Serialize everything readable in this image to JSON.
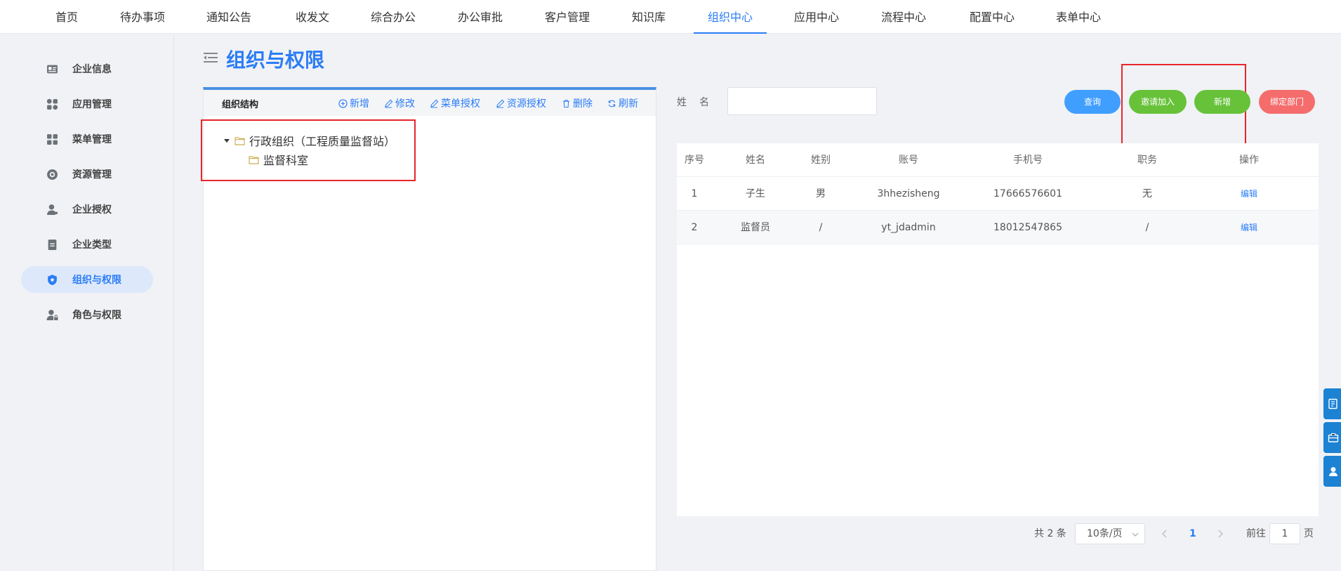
{
  "topnav": {
    "items": [
      "首页",
      "待办事项",
      "通知公告",
      "收发文",
      "综合办公",
      "办公审批",
      "客户管理",
      "知识库",
      "组织中心",
      "应用中心",
      "流程中心",
      "配置中心",
      "表单中心"
    ],
    "active_index": 8
  },
  "sidebar": {
    "items": [
      {
        "label": "企业信息",
        "icon": "id-card-icon"
      },
      {
        "label": "应用管理",
        "icon": "apps-icon"
      },
      {
        "label": "菜单管理",
        "icon": "menu-grid-icon"
      },
      {
        "label": "资源管理",
        "icon": "resource-icon"
      },
      {
        "label": "企业授权",
        "icon": "user-key-icon"
      },
      {
        "label": "企业类型",
        "icon": "document-icon"
      },
      {
        "label": "组织与权限",
        "icon": "shield-icon"
      },
      {
        "label": "角色与权限",
        "icon": "user-lock-icon"
      }
    ],
    "active_index": 6
  },
  "page": {
    "title": "组织与权限"
  },
  "org_panel": {
    "title": "组织结构",
    "toolbar": {
      "add": "新增",
      "edit": "修改",
      "menu_auth": "菜单授权",
      "resource_auth": "资源授权",
      "delete": "删除",
      "refresh": "刷新"
    },
    "tree": {
      "root": "行政组织（工程质量监督站）",
      "children": [
        "监督科室"
      ]
    }
  },
  "search": {
    "label": "姓名",
    "value": ""
  },
  "actions": {
    "query": "查询",
    "invite": "邀请加入",
    "add": "新增",
    "bind_dept": "绑定部门"
  },
  "colors": {
    "primary": "#2b7cf6",
    "query_btn": "#409eff",
    "green_btn": "#67c23a",
    "red_btn": "#f56c6c",
    "highlight": "#e8252b",
    "float_btn": "#1c82d4"
  },
  "table": {
    "headers": [
      "序号",
      "姓名",
      "姓别",
      "账号",
      "手机号",
      "职务",
      "操作"
    ],
    "rows": [
      [
        "1",
        "子生",
        "男",
        "3hhezisheng",
        "17666576601",
        "无",
        "编辑"
      ],
      [
        "2",
        "监督员",
        "/",
        "yt_jdadmin",
        "18012547865",
        "/",
        "编辑"
      ]
    ]
  },
  "pagination": {
    "total": "共 2 条",
    "page_size": "10条/页",
    "current": "1",
    "goto_prefix": "前往",
    "goto_value": "1",
    "goto_suffix": "页"
  },
  "float_buttons": [
    "form-icon",
    "briefcase-icon",
    "user-service-icon"
  ]
}
